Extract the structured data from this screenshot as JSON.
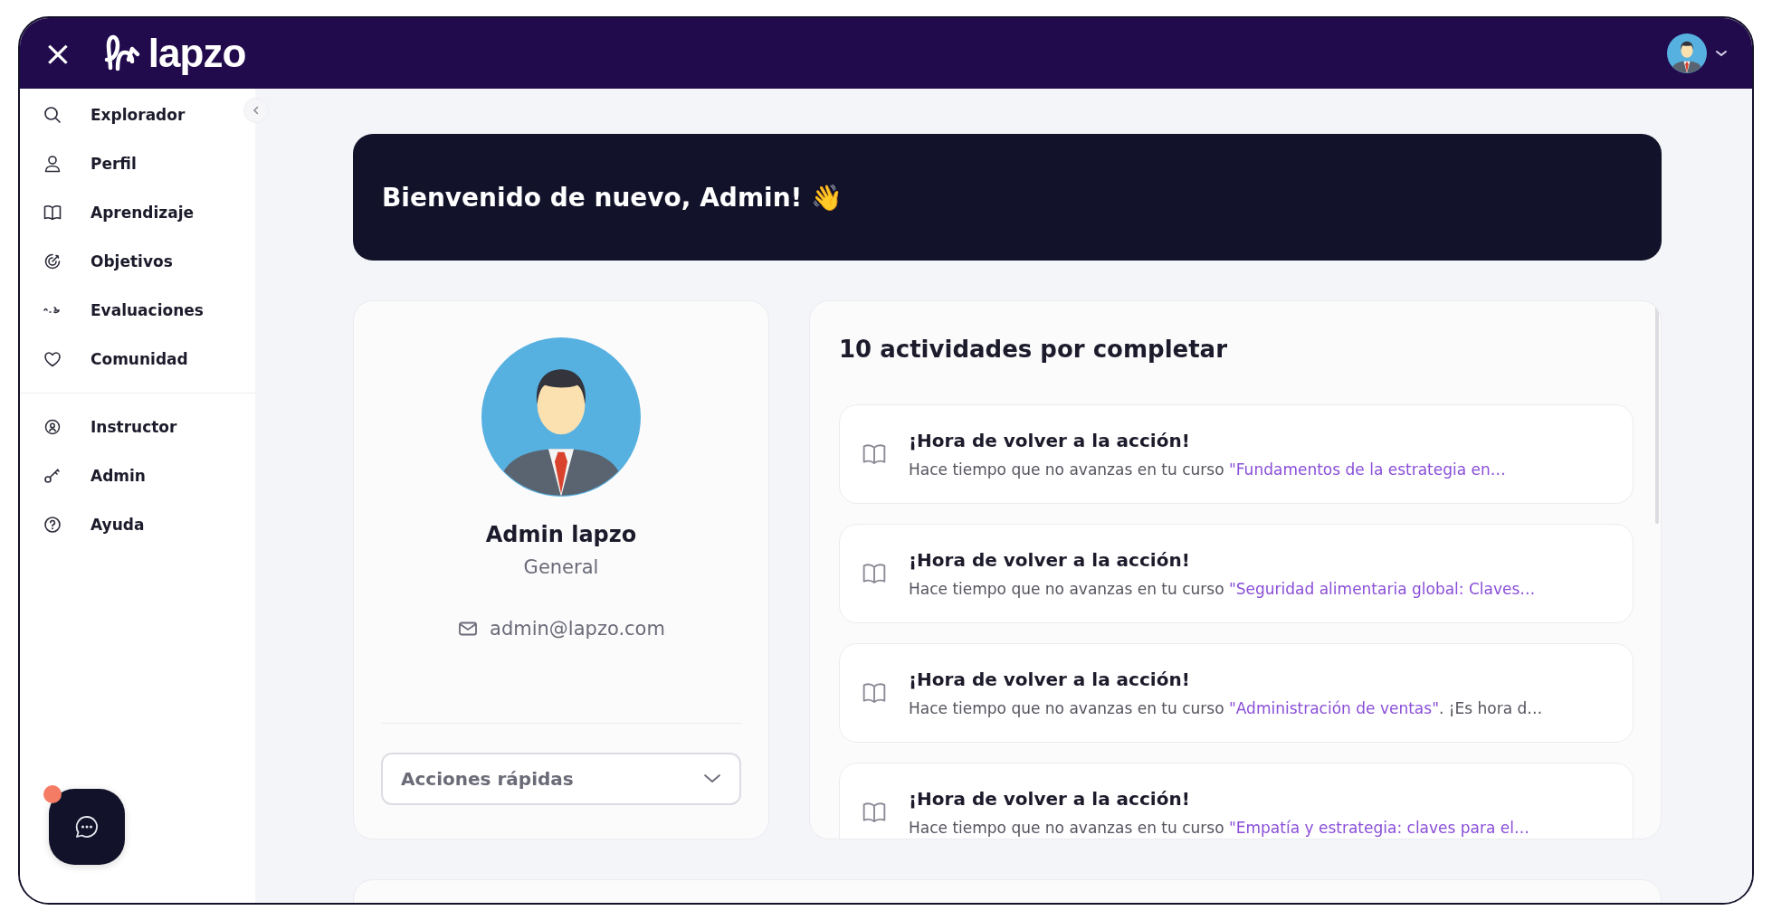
{
  "topbar": {
    "close": "×",
    "logo": "lapzo"
  },
  "sidebar": {
    "items": [
      {
        "label": "Explorador",
        "kind": "search"
      },
      {
        "label": "Perfil",
        "kind": "user"
      },
      {
        "label": "Aprendizaje",
        "kind": "book"
      },
      {
        "label": "Objetivos",
        "kind": "target"
      },
      {
        "label": "Evaluaciones",
        "kind": "eval"
      },
      {
        "label": "Comunidad",
        "kind": "heart"
      }
    ],
    "secondary_items": [
      {
        "label": "Instructor",
        "kind": "instructor"
      },
      {
        "label": "Admin",
        "kind": "key"
      },
      {
        "label": "Ayuda",
        "kind": "help"
      }
    ]
  },
  "banner": {
    "title": "Bienvenido de nuevo, Admin! 👋"
  },
  "profile": {
    "name": "Admin lapzo",
    "role": "General",
    "email": "admin@lapzo.com",
    "quick_actions": "Acciones rápidas"
  },
  "activities": {
    "title": "10 actividades por completar",
    "items": [
      {
        "title": "¡Hora de volver a la acción!",
        "text": "Hace tiempo que no avanzas en tu curso ",
        "course": "\"Fundamentos de la estrategia en…"
      },
      {
        "title": "¡Hora de volver a la acción!",
        "text": "Hace tiempo que no avanzas en tu curso ",
        "course": "\"Seguridad alimentaria global: Claves…"
      },
      {
        "title": "¡Hora de volver a la acción!",
        "text": "Hace tiempo que no avanzas en tu curso ",
        "course": "\"Administración de ventas\"",
        "rest": ". ¡Es hora d…"
      },
      {
        "title": "¡Hora de volver a la acción!",
        "text": "Hace tiempo que no avanzas en tu curso ",
        "course": "\"Empatía y estrategia: claves para el…"
      }
    ]
  }
}
